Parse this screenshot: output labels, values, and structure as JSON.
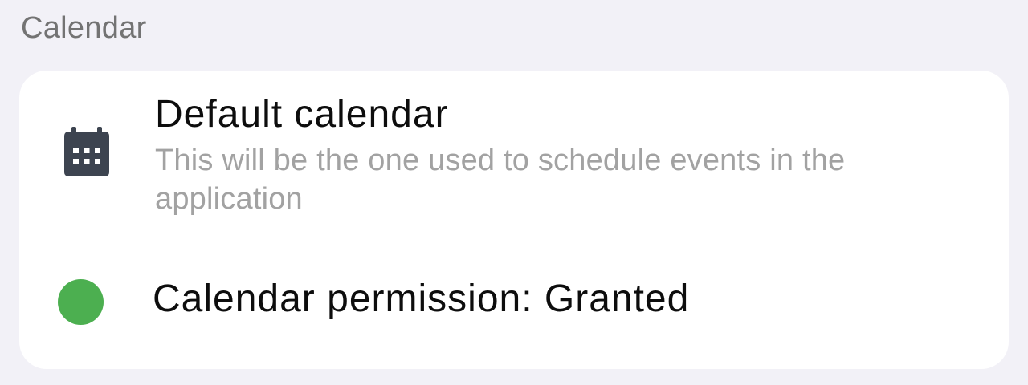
{
  "section": {
    "header": "Calendar"
  },
  "default_calendar": {
    "icon": "calendar-icon",
    "title": "Default calendar",
    "description": "This will be the one used to schedule events in the application"
  },
  "permission": {
    "label": "Calendar permission: Granted",
    "status_color": "#4caf50"
  },
  "colors": {
    "background": "#f2f1f7",
    "card": "#ffffff",
    "icon": "#3d4450"
  }
}
